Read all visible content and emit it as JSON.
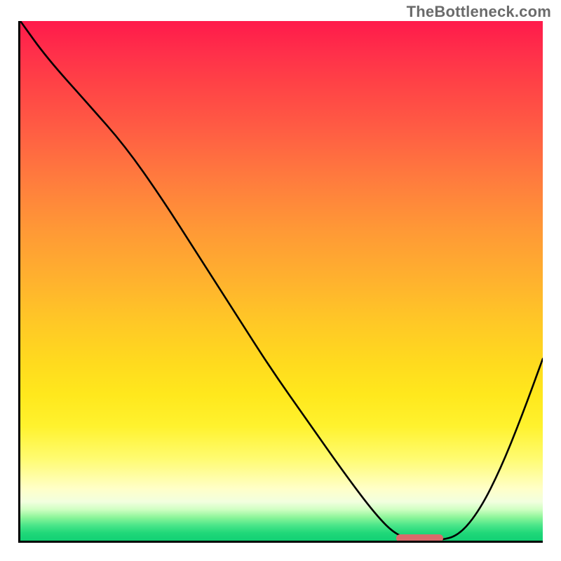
{
  "attribution": "TheBottleneck.com",
  "chart_data": {
    "type": "line",
    "title": "",
    "xlabel": "",
    "ylabel": "",
    "xlim": [
      0,
      100
    ],
    "ylim": [
      0,
      100
    ],
    "x": [
      0,
      5,
      13,
      20,
      27,
      34,
      41,
      48,
      55,
      62,
      68,
      72,
      76,
      80,
      84,
      88,
      92,
      96,
      100
    ],
    "values": [
      100,
      93,
      84,
      76,
      66,
      55,
      44,
      33,
      23,
      13,
      5,
      1,
      0,
      0,
      1,
      6,
      14,
      24,
      35
    ],
    "marker": {
      "x_start": 72,
      "x_end": 81,
      "y": 0.4
    },
    "gradient_note": "background encodes bottleneck severity: red high, green low"
  }
}
